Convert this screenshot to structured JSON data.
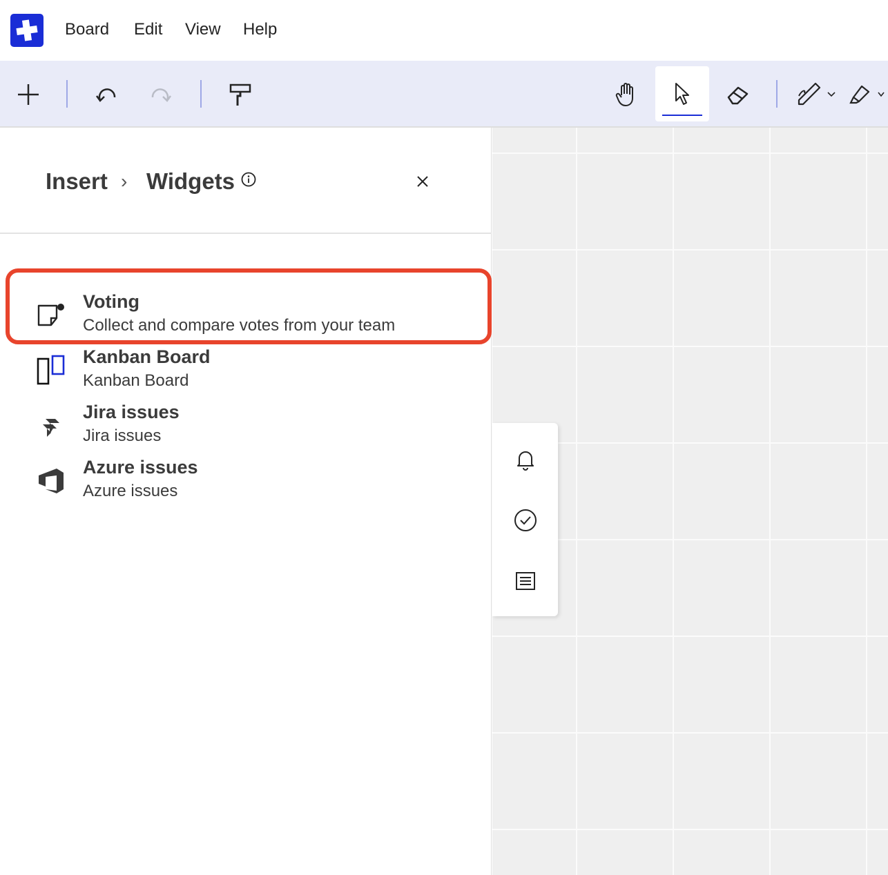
{
  "menubar": {
    "logo_icon": "plus-logo-icon",
    "items": [
      "Board",
      "Edit",
      "View",
      "Help"
    ]
  },
  "toolbar": {
    "left": [
      "add-icon",
      "undo-icon",
      "redo-icon",
      "format-painter-icon"
    ],
    "right": [
      "hand-icon",
      "pointer-icon",
      "eraser-icon",
      "pen-icon",
      "highlighter-icon"
    ],
    "active_tool": "pointer-icon"
  },
  "panel": {
    "breadcrumb_root": "Insert",
    "breadcrumb_sep": "›",
    "breadcrumb_current": "Widgets",
    "widgets": [
      {
        "title": "Voting",
        "description": "Collect and compare votes from your team",
        "icon": "voting-icon"
      },
      {
        "title": "Kanban Board",
        "description": "Kanban Board",
        "icon": "kanban-icon"
      },
      {
        "title": "Jira issues",
        "description": "Jira issues",
        "icon": "jira-icon"
      },
      {
        "title": "Azure issues",
        "description": "Azure issues",
        "icon": "azure-devops-icon"
      }
    ],
    "highlight_color": "#e8442c"
  },
  "side_rail": {
    "items": [
      "bell-icon",
      "check-circle-icon",
      "notes-list-icon"
    ]
  },
  "colors": {
    "brand": "#1a2dd6",
    "toolbar_bg": "#e9ebf8",
    "canvas_bg": "#efefef"
  }
}
